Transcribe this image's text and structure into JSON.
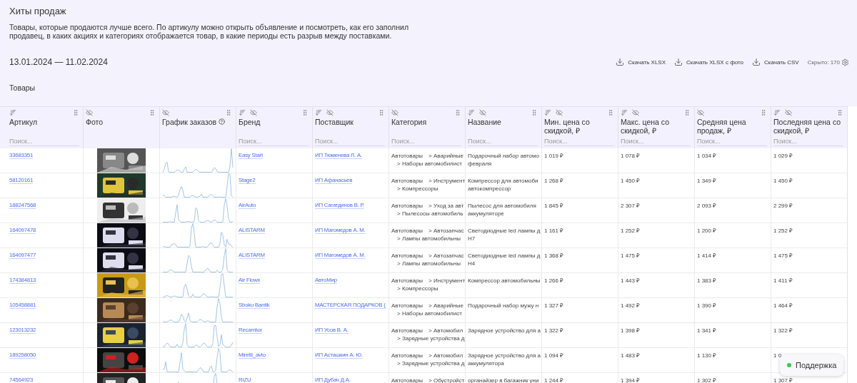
{
  "page": {
    "title": "Хиты продаж",
    "description": "Товары, которые продаются лучше всего. По артикулу можно открыть объявление и посмотреть, как его заполнил продавец, в каких акциях и категориях отображается товар, в какие периоды есть разрыв между поставками."
  },
  "date_range": "13.01.2024 — 11.02.2024",
  "actions": [
    {
      "label": "Скачать XLSX"
    },
    {
      "label": "Скачать XLSX с фото"
    },
    {
      "label": "Скачать CSV"
    }
  ],
  "hidden_count": "Скрыто: 170",
  "section_title": "Товары",
  "columns": [
    {
      "kind": "article",
      "title": "Артикул",
      "sortable": true,
      "hideable": false,
      "placeholder": "Поиск..."
    },
    {
      "title": "Фото",
      "sortable": false,
      "hideable": true
    },
    {
      "kind": "chart",
      "title": "График заказов",
      "sortable": false,
      "hideable": true,
      "help": true
    },
    {
      "kind": "brand",
      "title": "Бренд",
      "sortable": true,
      "hideable": true,
      "placeholder": "Поиск..."
    },
    {
      "kind": "supplier",
      "title": "Поставщик",
      "sortable": true,
      "hideable": true,
      "placeholder": "Поиск..."
    },
    {
      "kind": "category",
      "title": "Категория",
      "sortable": false,
      "hideable": true,
      "placeholder": "Поиск..."
    },
    {
      "kind": "name",
      "title": "Название",
      "sortable": true,
      "hideable": true,
      "placeholder": "Поиск..."
    },
    {
      "kind": "min_price",
      "title": "Мин. цена со скидкой, ₽",
      "sortable": true,
      "hideable": true,
      "placeholder": "Поиск..."
    },
    {
      "kind": "max_price",
      "title": "Макс. цена со скидкой, ₽",
      "sortable": true,
      "hideable": true,
      "placeholder": "Поиск..."
    },
    {
      "kind": "avg_price",
      "title": "Средняя цена продаж, ₽",
      "sortable": false,
      "hideable": true,
      "placeholder": "Поиск..."
    },
    {
      "kind": "last_price",
      "title": "Последняя цена со скидкой, ₽",
      "sortable": true,
      "hideable": true,
      "placeholder": "Поиск..."
    }
  ],
  "rows": [
    {
      "article": "33683351",
      "brand": "Easy Start",
      "supplier": "ИП Тюменева Л. А.",
      "category": [
        "Автотовары",
        "> Аварийные",
        "> Наборы автомобилист"
      ],
      "name": [
        "Подарочный набор автомо",
        "февраля"
      ],
      "min_price": "1 019 ₽",
      "max_price": "1 078 ₽",
      "avg_price": "1 034 ₽",
      "last_price": "1 029 ₽"
    },
    {
      "article": "58120161",
      "brand": "Stage2",
      "supplier": "ИП Афанасьев",
      "category": [
        "Автотовары",
        "> Инструмент",
        "> Компрессоры"
      ],
      "name": [
        "Компрессор для автомоби",
        "автокомпрессор"
      ],
      "min_price": "1 268 ₽",
      "max_price": "1 450 ₽",
      "avg_price": "1 349 ₽",
      "last_price": "1 450 ₽"
    },
    {
      "article": "188247568",
      "brand": "AirAuto",
      "supplier": "ИП Сагатдинов В. Р.",
      "category": [
        "Автотовары",
        "> Уход за авт",
        "> Пылесосы автомобиль"
      ],
      "name": [
        "Пылесос для автомобиля",
        "аккумуляторе"
      ],
      "min_price": "1 845 ₽",
      "max_price": "2 307 ₽",
      "avg_price": "2 093 ₽",
      "last_price": "2 299 ₽"
    },
    {
      "article": "164097478",
      "brand": "ALISTARM",
      "supplier": "ИП Магомедов А. М.",
      "category": [
        "Автотовары",
        "> Автозапчас",
        "> Лампы автомобильны"
      ],
      "name": [
        "Светодиодные led лампы д",
        "H7"
      ],
      "min_price": "1 161 ₽",
      "max_price": "1 252 ₽",
      "avg_price": "1 200 ₽",
      "last_price": "1 252 ₽"
    },
    {
      "article": "164097477",
      "brand": "ALISTARM",
      "supplier": "ИП Магомедов А. М.",
      "category": [
        "Автотовары",
        "> Автозапчас",
        "> Лампы автомобильны"
      ],
      "name": [
        "Светодиодные led лампы д",
        "H4"
      ],
      "min_price": "1 368 ₽",
      "max_price": "1 475 ₽",
      "avg_price": "1 414 ₽",
      "last_price": "1 475 ₽"
    },
    {
      "article": "174384813",
      "brand": "Air Flowx",
      "supplier": "АвтоМир",
      "category": [
        "Автотовары",
        "> Инструмент",
        "> Компрессоры"
      ],
      "name": [
        "Компрессор автомобильны"
      ],
      "min_price": "1 266 ₽",
      "max_price": "1 443 ₽",
      "avg_price": "1 383 ₽",
      "last_price": "1 411 ₽"
    },
    {
      "article": "105458881",
      "brand": "Sboku Bantik",
      "supplier": "МАСТЕРСКАЯ ПОДАРКОВ (",
      "category": [
        "Автотовары",
        "> Аварийные",
        "> Наборы автомобилист"
      ],
      "name": [
        "Подарочный набор мужу н"
      ],
      "min_price": "1 327 ₽",
      "max_price": "1 492 ₽",
      "avg_price": "1 390 ₽",
      "last_price": "1 464 ₽"
    },
    {
      "article": "123013232",
      "brand": "Recamlux",
      "supplier": "ИП Усов В. А.",
      "category": [
        "Автотовары",
        "> Автомобил",
        "> Зарядные устройства д"
      ],
      "name": [
        "Зарядное устройство для а"
      ],
      "min_price": "1 322 ₽",
      "max_price": "1 398 ₽",
      "avg_price": "1 341 ₽",
      "last_price": "1 322 ₽"
    },
    {
      "article": "189258050",
      "brand": "Miretti_avto",
      "supplier": "ИП Асташкин А. Ю.",
      "category": [
        "Автотовары",
        "> Автомобил",
        "> Зарядные устройства д"
      ],
      "name": [
        "Зарядное устройство для а",
        "аккумулятора"
      ],
      "min_price": "1 094 ₽",
      "max_price": "1 483 ₽",
      "avg_price": "1 130 ₽",
      "last_price": "1 0"
    },
    {
      "article": "74564923",
      "brand": "RIZU",
      "supplier": "ИП Дубач Д.А.",
      "category": [
        "Автотовары",
        "> Обустройст"
      ],
      "name": [
        "органайзер в багажник уни"
      ],
      "min_price": "1 244 ₽",
      "max_price": "1 394 ₽",
      "avg_price": "1 302 ₽",
      "last_price": "1 307 ₽"
    }
  ],
  "support": {
    "label": "Поддержка",
    "online": true
  }
}
